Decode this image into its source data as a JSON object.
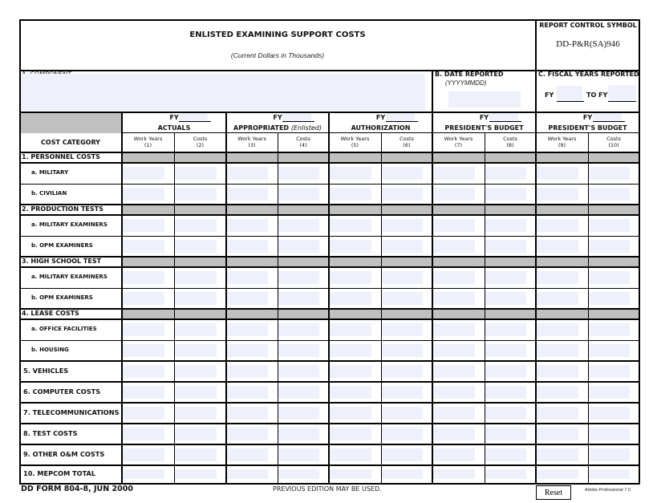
{
  "form": {
    "title": "ENLISTED EXAMINING SUPPORT COSTS",
    "subtitle": "(Current Dollars in Thousands)",
    "report_control_label": "REPORT CONTROL SYMBOL",
    "report_control_value": "DD-P&R(SA)946",
    "component_label": "A.  COMPONENT",
    "component_value": "",
    "date_label": "B. DATE REPORTED",
    "date_hint": "(YYYYMMDD)",
    "date_value": "",
    "fiscal_label": "C. FISCAL YEARS REPORTED",
    "fy_from_label": "FY",
    "fy_to_label": "TO FY",
    "fy_from_value": "",
    "fy_to_value": ""
  },
  "table": {
    "category_header": "COST CATEGORY",
    "fy_label": "FY",
    "groups": [
      {
        "title": "ACTUALS",
        "title_note": "",
        "fy_value": ""
      },
      {
        "title": "APPROPRIATED",
        "title_note": "(Enlisted)",
        "fy_value": ""
      },
      {
        "title": "AUTHORIZATION",
        "title_note": "",
        "fy_value": ""
      },
      {
        "title": "PRESIDENT'S BUDGET",
        "title_note": "",
        "fy_value": ""
      },
      {
        "title": "PRESIDENT'S BUDGET",
        "title_note": "",
        "fy_value": ""
      }
    ],
    "columns": [
      {
        "label": "Work Years",
        "num": "(1)"
      },
      {
        "label": "Costs",
        "num": "(2)"
      },
      {
        "label": "Work Years",
        "num": "(3)"
      },
      {
        "label": "Costs",
        "num": "(4)"
      },
      {
        "label": "Work Years",
        "num": "(5)"
      },
      {
        "label": "Costs",
        "num": "(6)"
      },
      {
        "label": "Work Years",
        "num": "(7)"
      },
      {
        "label": "Costs",
        "num": "(8)"
      },
      {
        "label": "Work Years",
        "num": "(9)"
      },
      {
        "label": "Costs",
        "num": "(10)"
      }
    ],
    "rows": [
      {
        "label": "1.  PERSONNEL COSTS",
        "type": "section"
      },
      {
        "label": "a.  MILITARY",
        "type": "sub"
      },
      {
        "label": "b.  CIVILIAN",
        "type": "sub"
      },
      {
        "label": "2.  PRODUCTION TESTS",
        "type": "section"
      },
      {
        "label": "a.  MILITARY EXAMINERS",
        "type": "sub"
      },
      {
        "label": "b.  OPM EXAMINERS",
        "type": "sub"
      },
      {
        "label": "3.  HIGH SCHOOL TEST",
        "type": "section"
      },
      {
        "label": "a.  MILITARY EXAMINERS",
        "type": "sub"
      },
      {
        "label": "b.  OPM EXAMINERS",
        "type": "sub"
      },
      {
        "label": "4.  LEASE COSTS",
        "type": "section"
      },
      {
        "label": "a.  OFFICE FACILITIES",
        "type": "sub"
      },
      {
        "label": "b.  HOUSING",
        "type": "sub"
      },
      {
        "label": "5.  VEHICLES",
        "type": "main"
      },
      {
        "label": "6.  COMPUTER COSTS",
        "type": "main"
      },
      {
        "label": "7.  TELECOMMUNICATIONS",
        "type": "main"
      },
      {
        "label": "8.  TEST COSTS",
        "type": "main"
      },
      {
        "label": "9.  OTHER O&M COSTS",
        "type": "main"
      },
      {
        "label": "10. MEPCOM TOTAL",
        "type": "main"
      }
    ]
  },
  "footer": {
    "form_number": "DD FORM 804-8, JUN 2000",
    "edition_note": "PREVIOUS EDITION MAY BE USED.",
    "reset_label": "Reset",
    "software_note": "Adobe Professional 7.0"
  }
}
